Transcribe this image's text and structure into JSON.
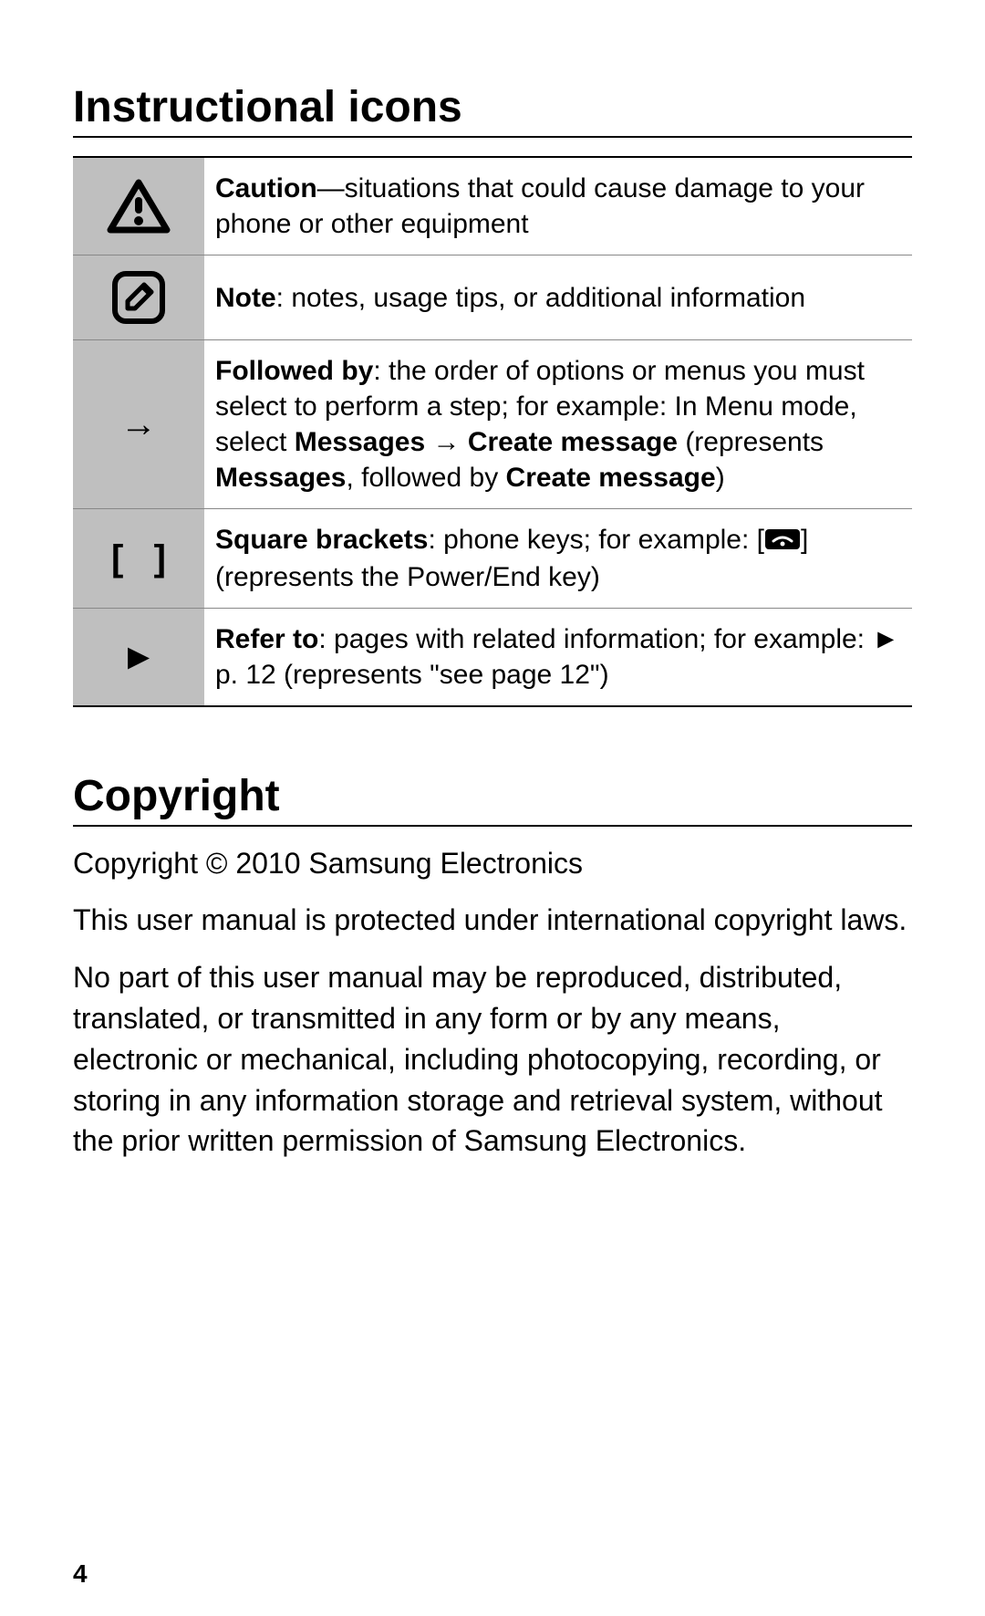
{
  "page_number": "4",
  "section1": {
    "title": "Instructional icons",
    "rows": [
      {
        "bold": "Caution",
        "sep": "—",
        "rest": "situations that could cause damage to your phone or other equipment"
      },
      {
        "bold": "Note",
        "sep": ": ",
        "rest": "notes, usage tips, or additional information"
      },
      {
        "bold": "Followed by",
        "pre": ": the order of options or menus you must select to perform a step; for example: In Menu mode, select ",
        "b1": "Messages",
        "arrow": " → ",
        "b2": "Create message",
        "mid": " (represents ",
        "b3": "Messages",
        "mid2": ", followed by ",
        "b4": "Create message",
        "end": ")"
      },
      {
        "bold": "Square brackets",
        "pre": ": phone keys; for example: [",
        "post": "] (represents the Power/End key)"
      },
      {
        "bold": "Refer to",
        "pre": ": pages with related information; for example: ► p. 12 (represents \"see page 12\")"
      }
    ]
  },
  "section2": {
    "title": "Copyright",
    "p1": "Copyright © 2010 Samsung Electronics",
    "p2": "This user manual is protected under international copyright laws.",
    "p3": "No part of this user manual may be reproduced, distributed, translated, or transmitted in any form or by any means, electronic or mechanical, including photocopying, recording, or storing in any information storage and retrieval system, without the prior written permission of Samsung Electronics."
  }
}
